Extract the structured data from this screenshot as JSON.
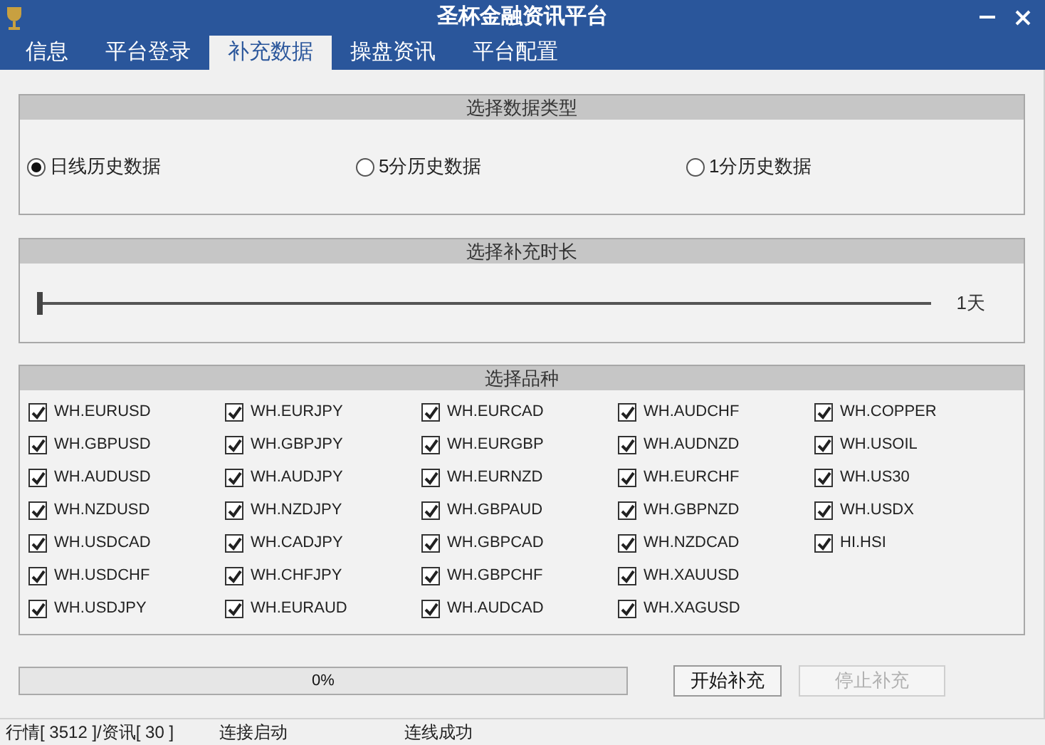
{
  "window": {
    "title": "圣杯金融资讯平台"
  },
  "tabs": [
    {
      "label": "信息",
      "selected": false
    },
    {
      "label": "平台登录",
      "selected": false
    },
    {
      "label": "补充数据",
      "selected": true
    },
    {
      "label": "操盘资讯",
      "selected": false
    },
    {
      "label": "平台配置",
      "selected": false
    }
  ],
  "data_type": {
    "title": "选择数据类型",
    "options": [
      {
        "label": "日线历史数据",
        "selected": true
      },
      {
        "label": "5分历史数据",
        "selected": false
      },
      {
        "label": "1分历史数据",
        "selected": false
      }
    ]
  },
  "duration": {
    "title": "选择补充时长",
    "level": 0,
    "reading": "1天"
  },
  "symbols": {
    "title": "选择品种",
    "columns": [
      [
        {
          "label": "WH.EURUSD",
          "checked": true
        },
        {
          "label": "WH.GBPUSD",
          "checked": true
        },
        {
          "label": "WH.AUDUSD",
          "checked": true
        },
        {
          "label": "WH.NZDUSD",
          "checked": true
        },
        {
          "label": "WH.USDCAD",
          "checked": true
        },
        {
          "label": "WH.USDCHF",
          "checked": true
        },
        {
          "label": "WH.USDJPY",
          "checked": true
        }
      ],
      [
        {
          "label": "WH.EURJPY",
          "checked": true
        },
        {
          "label": "WH.GBPJPY",
          "checked": true
        },
        {
          "label": "WH.AUDJPY",
          "checked": true
        },
        {
          "label": "WH.NZDJPY",
          "checked": true
        },
        {
          "label": "WH.CADJPY",
          "checked": true
        },
        {
          "label": "WH.CHFJPY",
          "checked": true
        },
        {
          "label": "WH.EURAUD",
          "checked": true
        }
      ],
      [
        {
          "label": "WH.EURCAD",
          "checked": true
        },
        {
          "label": "WH.EURGBP",
          "checked": true
        },
        {
          "label": "WH.EURNZD",
          "checked": true
        },
        {
          "label": "WH.GBPAUD",
          "checked": true
        },
        {
          "label": "WH.GBPCAD",
          "checked": true
        },
        {
          "label": "WH.GBPCHF",
          "checked": true
        },
        {
          "label": "WH.AUDCAD",
          "checked": true
        }
      ],
      [
        {
          "label": "WH.AUDCHF",
          "checked": true
        },
        {
          "label": "WH.AUDNZD",
          "checked": true
        },
        {
          "label": "WH.EURCHF",
          "checked": true
        },
        {
          "label": "WH.GBPNZD",
          "checked": true
        },
        {
          "label": "WH.NZDCAD",
          "checked": true
        },
        {
          "label": "WH.XAUUSD",
          "checked": true
        },
        {
          "label": "WH.XAGUSD",
          "checked": true
        }
      ],
      [
        {
          "label": "WH.COPPER",
          "checked": true
        },
        {
          "label": "WH.USOIL",
          "checked": true
        },
        {
          "label": "WH.US30",
          "checked": true
        },
        {
          "label": "WH.USDX",
          "checked": true
        },
        {
          "label": "HI.HSI",
          "checked": true
        }
      ]
    ]
  },
  "progress": {
    "level": 0,
    "reading": "0%"
  },
  "buttons": [
    {
      "label": "开始补充",
      "disabled": false
    },
    {
      "label": "停止补充",
      "disabled": true
    }
  ],
  "status_bar": [
    "行情[ 3512 ]/资讯[ 30 ]",
    "连接启动",
    "连线成功"
  ]
}
